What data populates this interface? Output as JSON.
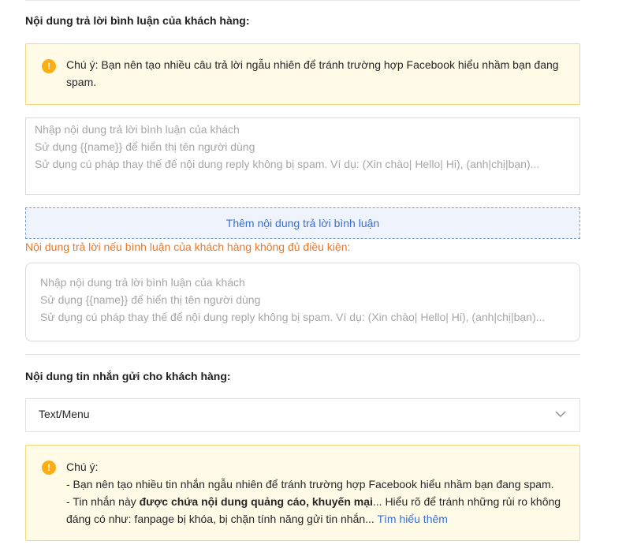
{
  "reply_section": {
    "title": "Nội dung trả lời bình luận của khách hàng:",
    "notice": "Chú ý: Bạn nên tạo nhiều câu trả lời ngẫu nhiên để tránh trường hợp Facebook hiểu nhầm bạn đang spam.",
    "placeholder_lines": [
      "Nhập nội dung trả lời bình luận của khách",
      "Sử dụng {{name}} để hiển thị tên người dùng",
      "Sử dụng cú pháp thay thế để nội dung reply không bị spam. Ví dụ: (Xin chào| Hello| Hi), (anh|chị|bạn)..."
    ],
    "add_button_label": "Thêm nội dung trả lời bình luận"
  },
  "ineligible_section": {
    "label": "Nội dung trả lời nếu bình luận của khách hàng không đủ điều kiện:",
    "placeholder_lines": [
      "Nhập nội dung trả lời bình luận của khách",
      "Sử dụng {{name}} để hiển thị tên người dùng",
      "Sử dụng cú pháp thay thế để nội dung reply không bị spam. Ví dụ: (Xin chào| Hello| Hi), (anh|chị|bạn)..."
    ]
  },
  "message_section": {
    "title": "Nội dung tin nhắn gửi cho khách hàng:",
    "select_value": "Text/Menu",
    "notice": {
      "heading": "Chú ý:",
      "line1": "- Bạn nên tạo nhiều tin nhắn ngẫu nhiên để tránh trường hợp Facebook hiểu nhầm bạn đang spam.",
      "line2_prefix": "- Tin nhắn này ",
      "line2_bold": "được chứa nội dung quảng cáo, khuyến mại",
      "line2_suffix": "... Hiểu rõ để tránh những rủi ro không",
      "line3_text": "đáng có như: fanpage bị khóa, bị chặn tính năng gửi tin nhắn... ",
      "learn_more": "Tìm hiểu thêm"
    }
  },
  "icons": {
    "warning": "warning-icon",
    "chevron": "chevron-down-icon"
  },
  "colors": {
    "accent": "#3b6fd4",
    "warning": "#faad14",
    "orange_label": "#e8782a",
    "notice_bg": "#fffbe6"
  }
}
